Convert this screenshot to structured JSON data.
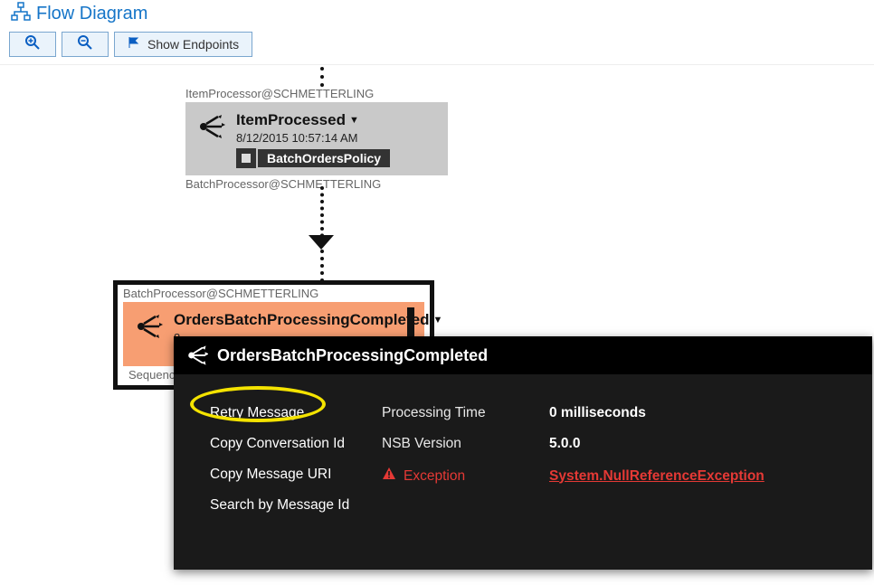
{
  "header": {
    "title": "Flow Diagram"
  },
  "toolbar": {
    "show_endpoints": "Show Endpoints"
  },
  "node1": {
    "endpoint": "ItemProcessor@SCHMETTERLING",
    "title": "ItemProcessed",
    "time": "8/12/2015 10:57:14 AM",
    "tag": "BatchOrdersPolicy",
    "destination": "BatchProcessor@SCHMETTERLING"
  },
  "node2": {
    "endpoint": "BatchProcessor@SCHMETTERLING",
    "title": "OrdersBatchProcessingCompleted",
    "time_prefix": "8",
    "sequence_prefix": "Sequence"
  },
  "popup": {
    "title": "OrdersBatchProcessingCompleted",
    "menu": {
      "retry": "Retry Message",
      "copy_conv": "Copy Conversation Id",
      "copy_uri": "Copy Message URI",
      "search": "Search by Message Id"
    },
    "details": {
      "proc_time_label": "Processing Time",
      "proc_time_value": "0 milliseconds",
      "nsb_label": "NSB Version",
      "nsb_value": "5.0.0",
      "exc_label": "Exception",
      "exc_value": "System.NullReferenceException"
    }
  }
}
